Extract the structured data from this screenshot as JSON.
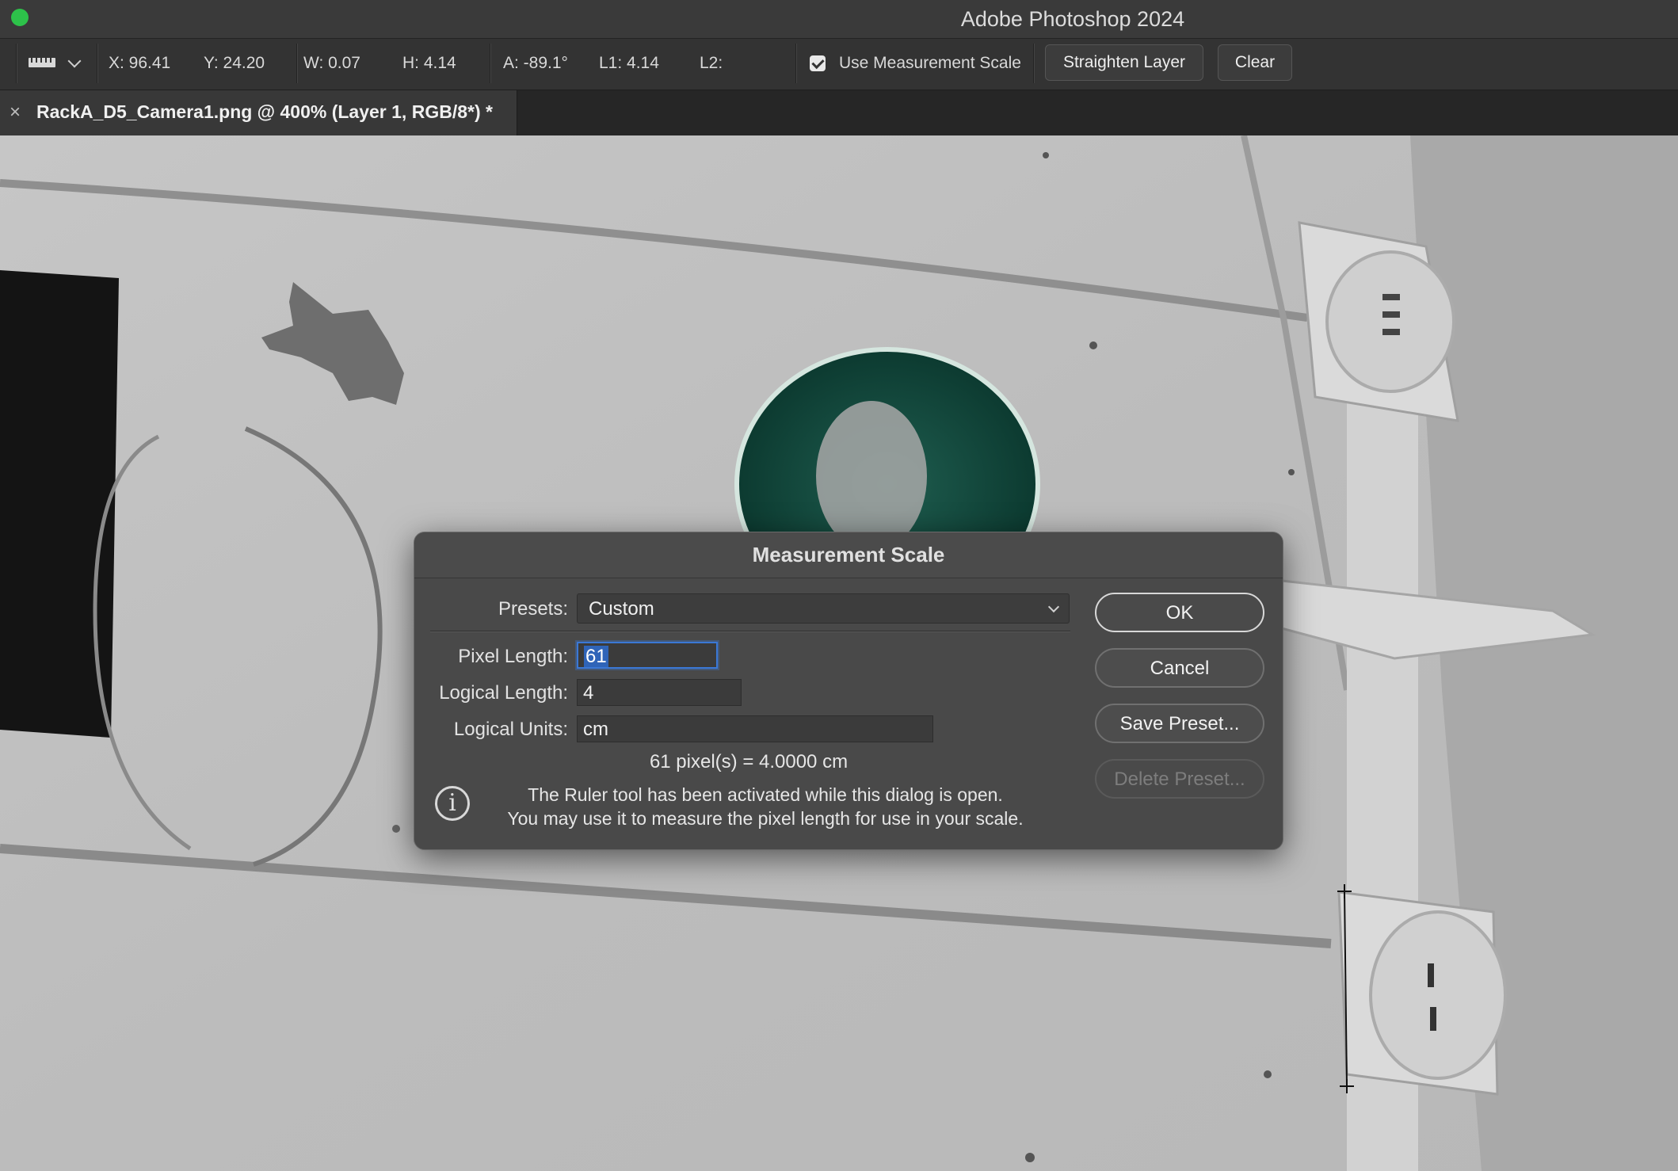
{
  "app": {
    "title": "Adobe Photoshop 2024"
  },
  "options_bar": {
    "x": "X: 96.41",
    "y": "Y: 24.20",
    "w": "W: 0.07",
    "h": "H: 4.14",
    "a": "A: -89.1°",
    "l1": "L1: 4.14",
    "l2": "L2:",
    "use_measurement_scale_label": "Use Measurement Scale",
    "use_measurement_scale_checked": true,
    "straighten_label": "Straighten Layer",
    "clear_label": "Clear",
    "tool_icon": "ruler-icon"
  },
  "document": {
    "tab_title": "RackA_D5_Camera1.png @ 400% (Layer 1, RGB/8*) *",
    "close_glyph": "×"
  },
  "dialog": {
    "title": "Measurement Scale",
    "presets_label": "Presets:",
    "presets_value": "Custom",
    "pixel_length_label": "Pixel Length:",
    "pixel_length_value": "61",
    "logical_length_label": "Logical Length:",
    "logical_length_value": "4",
    "logical_units_label": "Logical Units:",
    "logical_units_value": "cm",
    "result": "61 pixel(s) = 4.0000 cm",
    "info_line1": "The Ruler tool has been activated while this dialog is open.",
    "info_line2": "You may use it to measure the pixel length for use in your scale.",
    "info_glyph": "i",
    "buttons": {
      "ok": "OK",
      "cancel": "Cancel",
      "save_preset": "Save Preset...",
      "delete_preset": "Delete Preset..."
    }
  },
  "colors": {
    "accent_focus": "#3a78d6",
    "traffic_green": "#2dc24a",
    "ui_dark": "#333333"
  }
}
